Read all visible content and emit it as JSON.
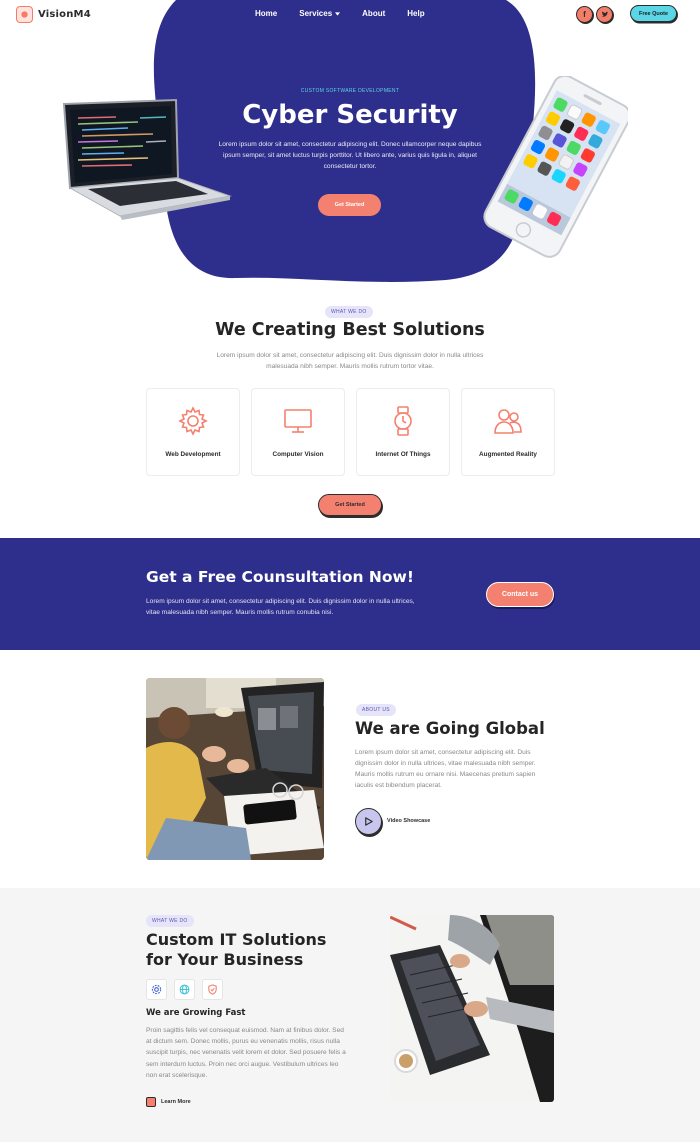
{
  "header": {
    "brand": "VisionM4",
    "nav": [
      {
        "label": "Home"
      },
      {
        "label": "Services",
        "has_dropdown": true
      },
      {
        "label": "About"
      },
      {
        "label": "Help"
      }
    ],
    "social": [
      {
        "icon": "facebook-icon",
        "glyph": "f"
      },
      {
        "icon": "twitter-icon",
        "glyph": "t"
      }
    ],
    "quote_label": "Free Quote"
  },
  "hero": {
    "eyebrow": "CUSTOM SOFTWARE DEVELOPMENT",
    "title": "Cyber Security",
    "description": "Lorem ipsum dolor sit amet, consectetur adipiscing elit. Donec ullamcorper neque dapibus ipsum semper, sit amet luctus turpis porttitor. Ut libero ante, varius quis ligula in, aliquet consectetur tortor.",
    "cta_label": "Get Started"
  },
  "solutions": {
    "eyebrow": "WHAT WE DO",
    "title": "We Creating Best Solutions",
    "description": "Lorem ipsum dolor sit amet, consectetur adipiscing elit. Duis dignissim dolor in nulla ultrices malesuada nibh semper. Mauris mollis rutrum tortor vitae.",
    "cards": [
      {
        "label": "Web Development",
        "icon": "gear-icon"
      },
      {
        "label": "Computer Vision",
        "icon": "monitor-icon"
      },
      {
        "label": "Internet Of Things",
        "icon": "smartwatch-icon"
      },
      {
        "label": "Augmented Reality",
        "icon": "users-icon"
      }
    ],
    "cta_label": "Get Started"
  },
  "consultation": {
    "title": "Get a Free Counsultation Now!",
    "description": "Lorem ipsum dolor sit amet, consectetur adipiscing elit. Duis dignissim dolor in nulla ultrices, vitae malesuada nibh semper. Mauris mollis rutrum conubia nisi.",
    "cta_label": "Contact us"
  },
  "about": {
    "eyebrow": "ABOUT US",
    "title": "We are Going Global",
    "description": "Lorem ipsum dolor sit amet, consectetur adipiscing elit. Duis dignissim dolor in nulla ultrices, vitae malesuada nibh semper. Mauris mollis rutrum eu ornare nisi. Maecenas pretium sapien iaculis est bibendum placerat.",
    "video_label": "Video Showcase"
  },
  "custom_it": {
    "eyebrow": "WHAT WE DO",
    "title": "Custom IT Solutions for Your Business",
    "icons": [
      "settings-icon",
      "globe-icon",
      "shield-icon"
    ],
    "subtitle": "We are Growing Fast",
    "description": "Proin sagittis felis vel consequat euismod. Nam at finibus dolor. Sed at dictum sem. Donec mollis, purus eu venenatis mollis, risus nulla suscipit turpis, nec venenatis velit lorem et dolor. Sed posuere felis a sem interdum luctus. Proin nec orci augue. Vestibulum ultrices leo non erat scelerisque.",
    "link_label": "Learn More"
  },
  "colors": {
    "primary": "#2e2f8c",
    "accent": "#f4806f",
    "cyan": "#5ad6e6",
    "pill_bg": "#e6e4f8"
  }
}
